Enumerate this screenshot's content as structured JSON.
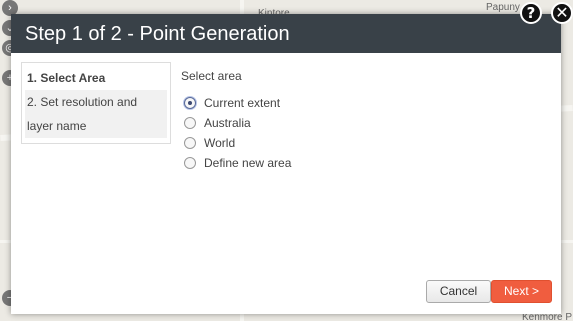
{
  "map": {
    "labels": [
      "Kintore",
      "Papuny",
      "Kenmore P"
    ]
  },
  "dialog": {
    "title": "Step 1 of 2 - Point Generation",
    "help_icon": "?",
    "close_icon": "✕",
    "steps": [
      {
        "label": "1. Select Area",
        "active": true
      },
      {
        "label": "2. Set resolution and layer name",
        "active": false
      }
    ],
    "content": {
      "title": "Select area",
      "options": [
        {
          "label": "Current extent",
          "selected": true
        },
        {
          "label": "Australia",
          "selected": false
        },
        {
          "label": "World",
          "selected": false
        },
        {
          "label": "Define new area",
          "selected": false
        }
      ]
    },
    "buttons": {
      "cancel": "Cancel",
      "next": "Next >"
    }
  },
  "colors": {
    "titlebar": "#394148",
    "next_button": "#f05d3f"
  }
}
